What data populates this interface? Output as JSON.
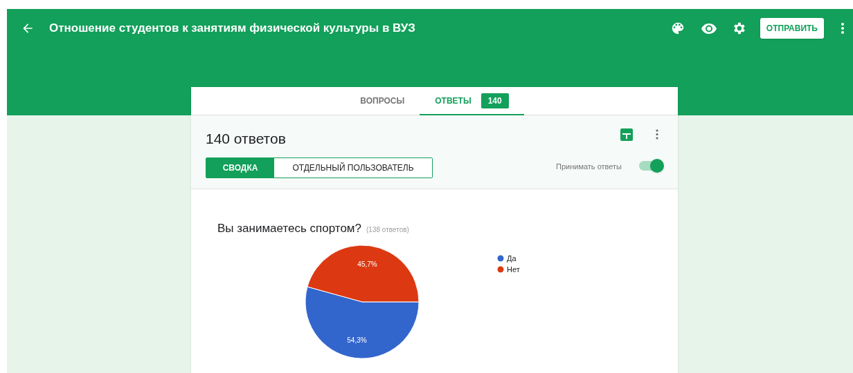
{
  "header": {
    "title": "Отношение студентов к занятиям физической культуры в ВУЗ",
    "send_button": "ОТПРАВИТЬ"
  },
  "tabs": [
    {
      "label": "ВОПРОСЫ",
      "selected": false
    },
    {
      "label": "ОТВЕТЫ",
      "selected": true,
      "badge": "140"
    }
  ],
  "responses": {
    "title": "140 ответов",
    "views": [
      {
        "label": "СВОДКА",
        "selected": true
      },
      {
        "label": "ОТДЕЛЬНЫЙ ПОЛЬЗОВАТЕЛЬ",
        "selected": false
      }
    ],
    "accepting_label": "Принимать ответы",
    "accepting": true
  },
  "question": {
    "title": "Вы занимаетесь спортом?",
    "count": "(138 ответов)",
    "chart_data": {
      "type": "pie",
      "categories": [
        "Да",
        "Нет"
      ],
      "series": [
        {
          "values": [
            54.3,
            45.7
          ]
        }
      ],
      "legend": "right",
      "colors": [
        "#3366cc",
        "#dc3912"
      ],
      "value_labels": [
        "54,3%",
        "45,7%"
      ]
    }
  }
}
